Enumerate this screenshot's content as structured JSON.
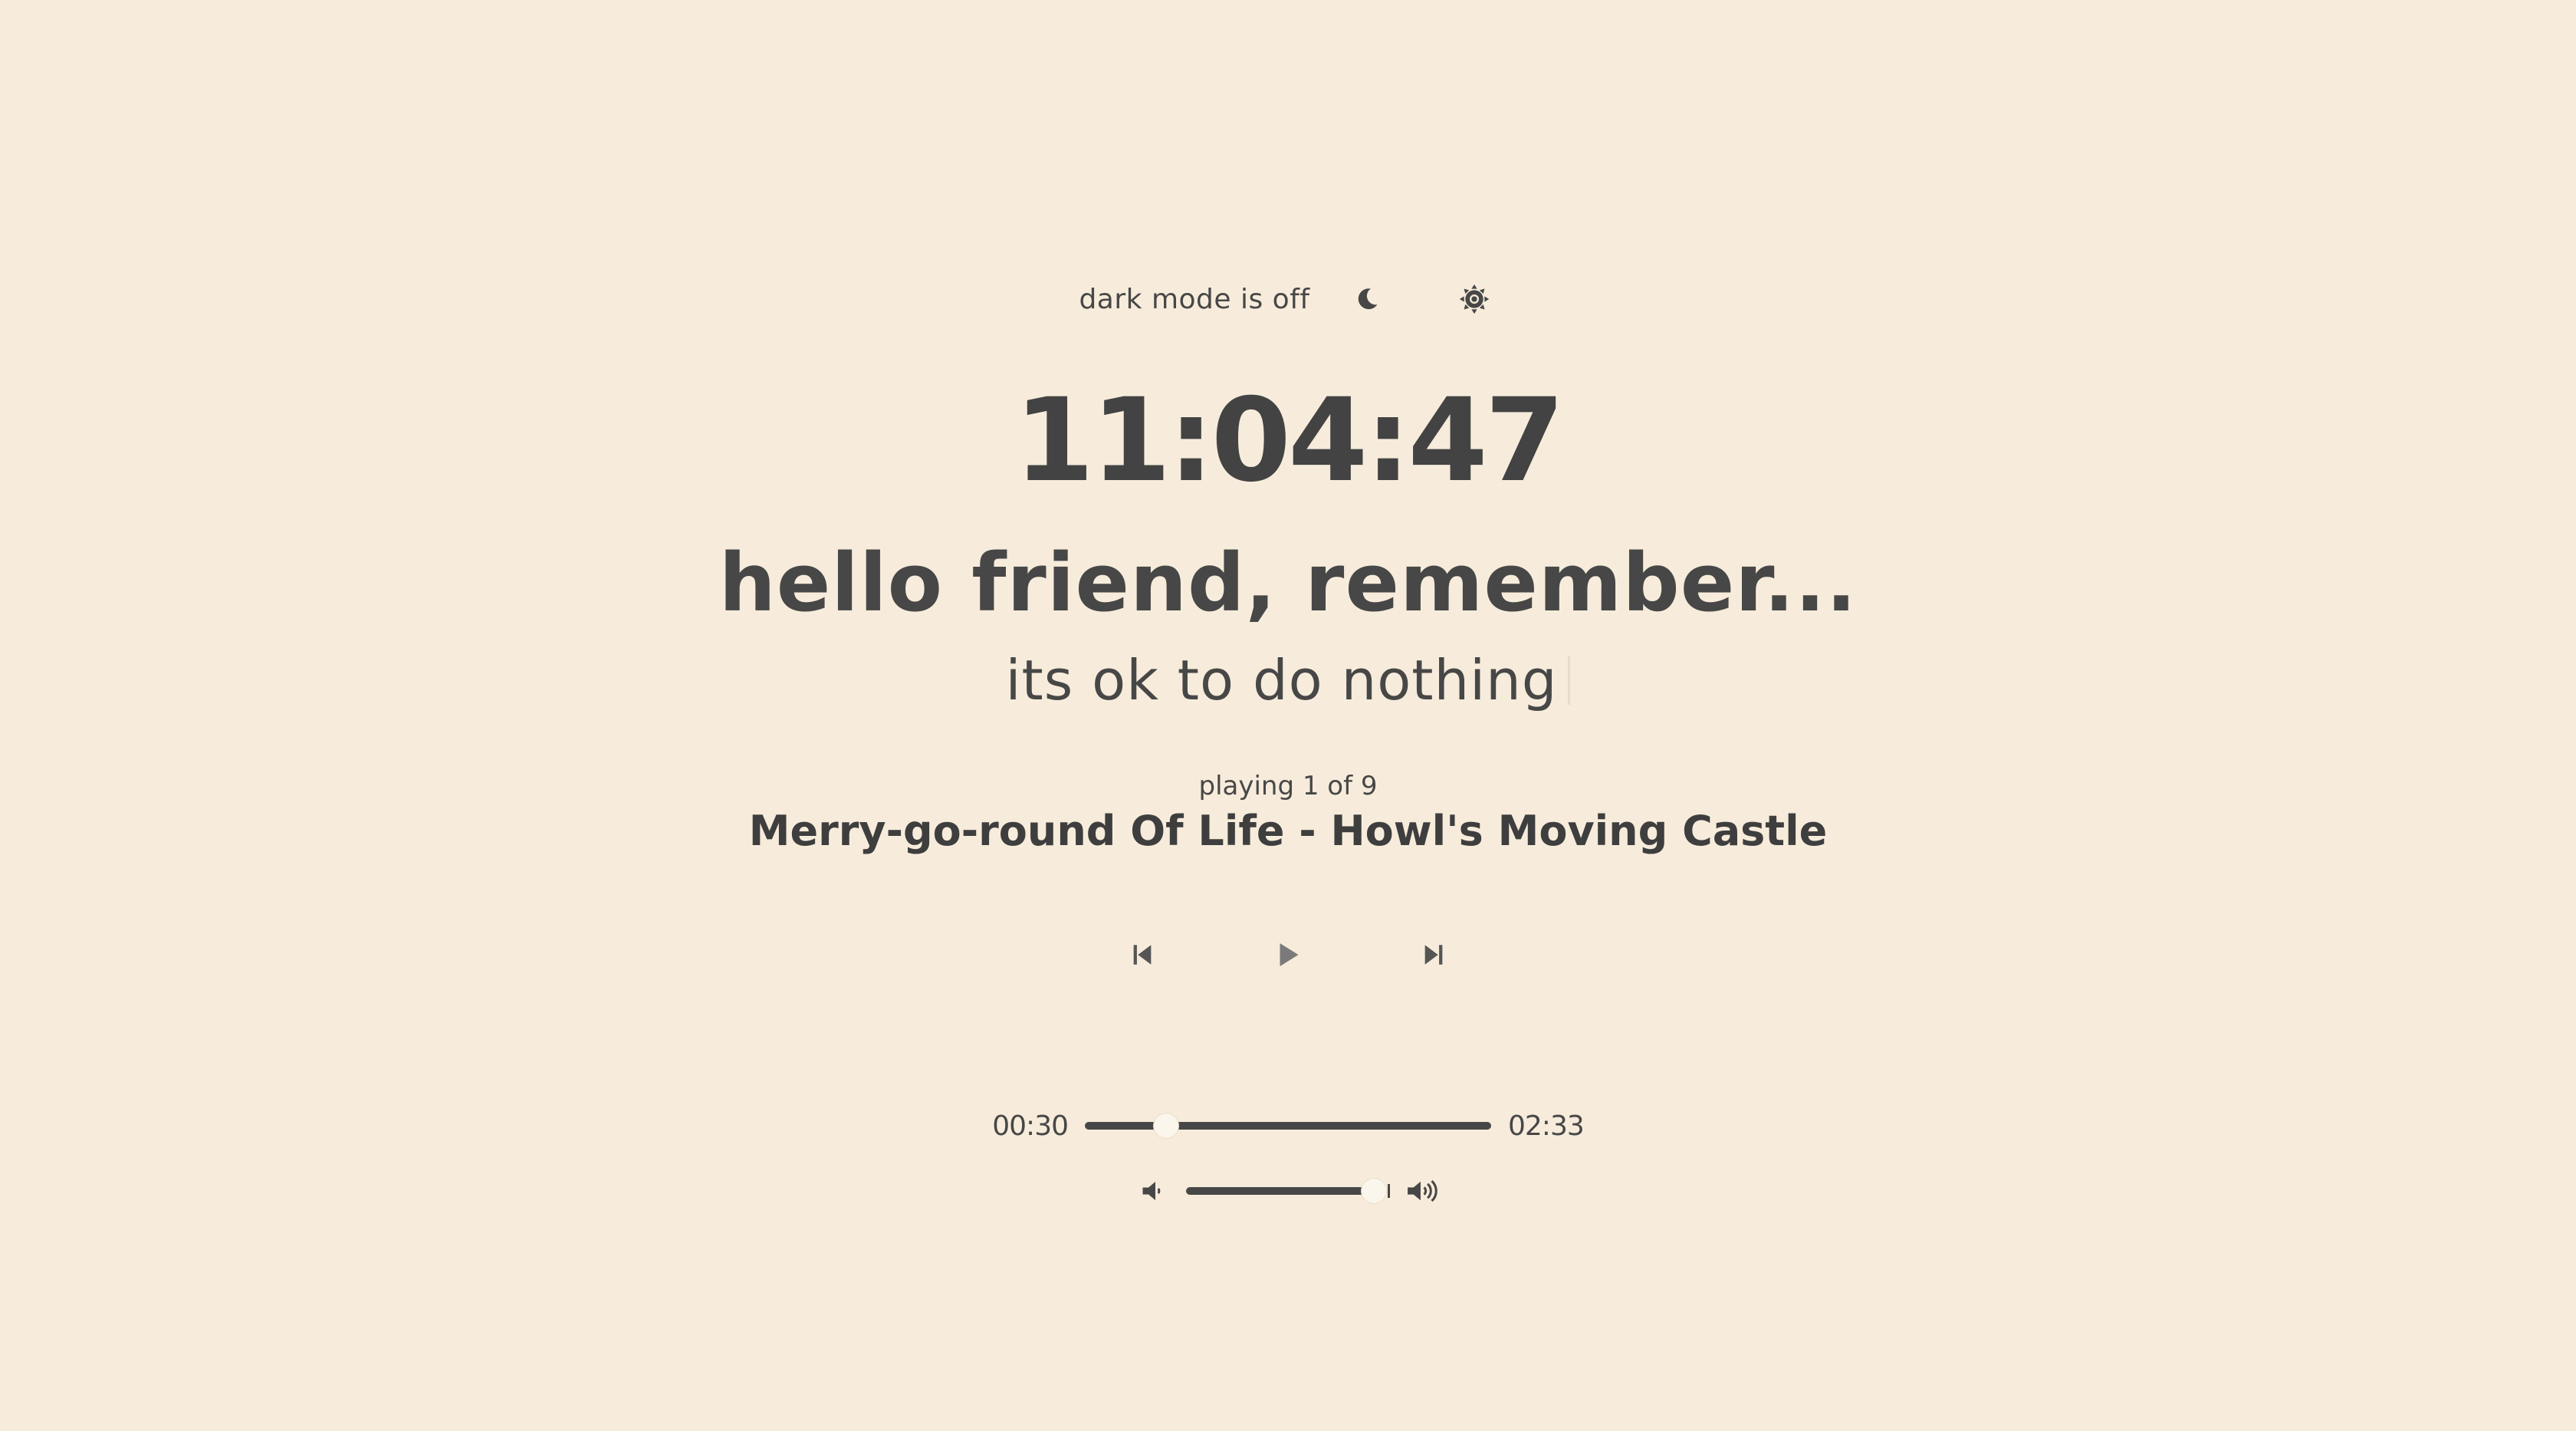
{
  "theme": {
    "background": "#f7ecdb",
    "text": "#474747",
    "thumb": "#fbf6ec"
  },
  "dark_mode": {
    "label": "dark mode is off",
    "moon_icon": "moon-icon",
    "sun_icon": "sun-icon"
  },
  "clock": {
    "time": "11:04:47"
  },
  "greeting": {
    "title": "hello friend, remember...",
    "message": "its ok to do nothing"
  },
  "player": {
    "status": "playing 1 of 9",
    "track_title": "Merry-go-round Of Life - Howl's Moving Castle",
    "controls": {
      "previous_icon": "skip-previous-icon",
      "play_icon": "play-icon",
      "next_icon": "skip-next-icon"
    },
    "progress": {
      "elapsed": "00:30",
      "duration": "02:33",
      "fraction": 0.2
    },
    "volume": {
      "level": 0.92,
      "mute_icon": "volume-low-icon",
      "max_icon": "volume-high-icon"
    }
  }
}
